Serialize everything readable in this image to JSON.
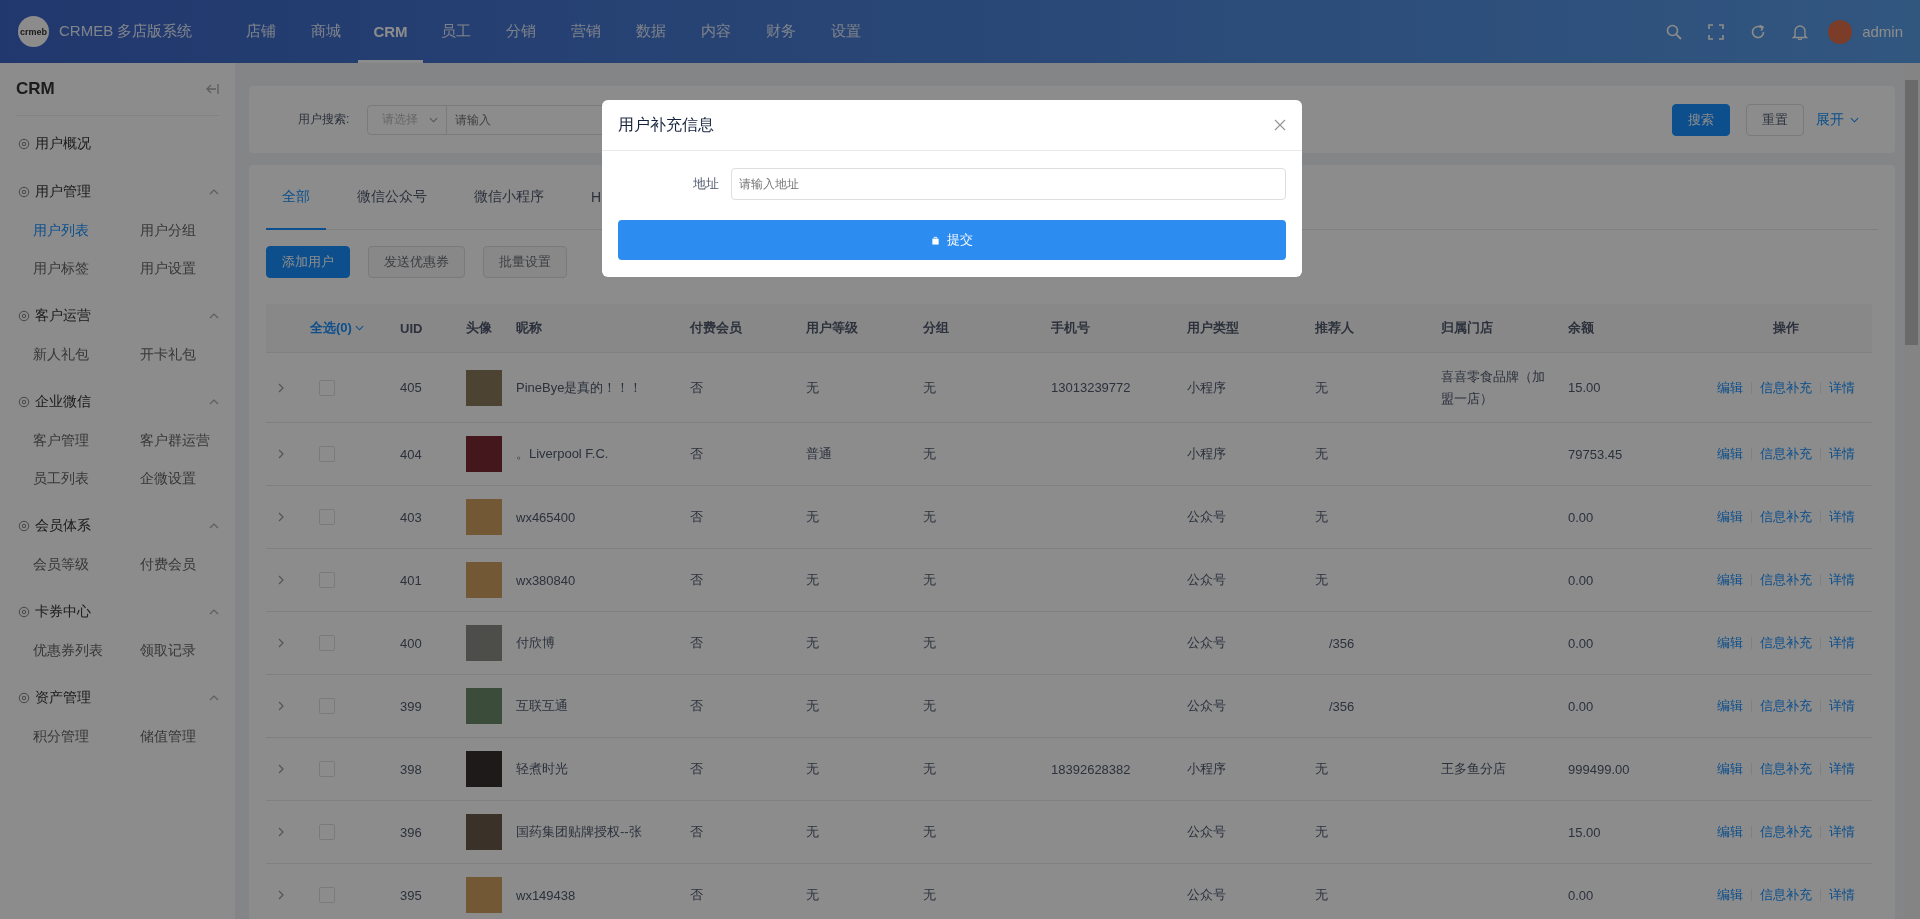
{
  "header": {
    "logo_text": "crmeb",
    "system_name": "CRMEB 多店版系统",
    "nav": [
      {
        "label": "店铺",
        "selected": false
      },
      {
        "label": "商城",
        "selected": false
      },
      {
        "label": "CRM",
        "selected": true
      },
      {
        "label": "员工",
        "selected": false
      },
      {
        "label": "分销",
        "selected": false
      },
      {
        "label": "营销",
        "selected": false
      },
      {
        "label": "数据",
        "selected": false
      },
      {
        "label": "内容",
        "selected": false
      },
      {
        "label": "财务",
        "selected": false
      },
      {
        "label": "设置",
        "selected": false
      }
    ],
    "user": "admin"
  },
  "sidebar": {
    "title": "CRM",
    "groups": [
      {
        "label": "用户概况"
      },
      {
        "label": "用户管理",
        "expanded": true,
        "children": [
          {
            "label": "用户列表",
            "selected": true
          },
          {
            "label": "用户分组",
            "selected": false
          },
          {
            "label": "用户标签",
            "selected": false
          },
          {
            "label": "用户设置",
            "selected": false
          }
        ]
      },
      {
        "label": "客户运营",
        "expanded": true,
        "children": [
          {
            "label": "新人礼包",
            "selected": false
          },
          {
            "label": "开卡礼包",
            "selected": false
          }
        ]
      },
      {
        "label": "企业微信",
        "expanded": true,
        "children": [
          {
            "label": "客户管理",
            "selected": false
          },
          {
            "label": "客户群运营",
            "selected": false
          },
          {
            "label": "员工列表",
            "selected": false
          },
          {
            "label": "企微设置",
            "selected": false
          }
        ]
      },
      {
        "label": "会员体系",
        "expanded": true,
        "children": [
          {
            "label": "会员等级",
            "selected": false
          },
          {
            "label": "付费会员",
            "selected": false
          }
        ]
      },
      {
        "label": "卡券中心",
        "expanded": true,
        "children": [
          {
            "label": "优惠券列表",
            "selected": false
          },
          {
            "label": "领取记录",
            "selected": false
          }
        ]
      },
      {
        "label": "资产管理",
        "expanded": true,
        "children": [
          {
            "label": "积分管理",
            "selected": false
          },
          {
            "label": "储值管理",
            "selected": false
          }
        ]
      }
    ]
  },
  "filter": {
    "label": "用户搜索:",
    "select_placeholder": "请选择",
    "input_placeholder": "请输入",
    "buttons": [
      {
        "label": "搜索",
        "kind": "primary"
      },
      {
        "label": "重置",
        "kind": "default"
      }
    ],
    "toggle": "展开"
  },
  "tabs": [
    {
      "label": "全部",
      "selected": true
    },
    {
      "label": "微信公众号",
      "selected": false
    },
    {
      "label": "微信小程序",
      "selected": false
    },
    {
      "label": "H",
      "selected": false
    }
  ],
  "actions": [
    {
      "label": "添加用户",
      "disabled": false
    },
    {
      "label": "发送优惠券",
      "disabled": true
    },
    {
      "label": "批量设置",
      "disabled": true
    }
  ],
  "table": {
    "select_all": "全选(0)",
    "columns": [
      "UID",
      "头像",
      "昵称",
      "付费会员",
      "用户等级",
      "分组",
      "手机号",
      "用户类型",
      "推荐人",
      "归属门店",
      "余额",
      "操作"
    ],
    "rows": [
      {
        "checked": false,
        "uid": "405",
        "nickname": "PineBye是真的！！！",
        "paid": "否",
        "level": "无",
        "group": "无",
        "phone": "13013239772",
        "type": "小程序",
        "referrer": "无",
        "store": "喜喜零食品牌（加盟一店）",
        "balance": "15.00",
        "actions": [
          "编辑",
          "信息补充",
          "详情"
        ]
      },
      {
        "checked": false,
        "uid": "404",
        "nickname": "。Liverpool F.C.",
        "paid": "否",
        "level": "普通",
        "group": "无",
        "phone": "",
        "type": "小程序",
        "referrer": "无",
        "store": "",
        "balance": "79753.45",
        "actions": [
          "编辑",
          "信息补充",
          "详情"
        ]
      },
      {
        "checked": false,
        "uid": "403",
        "nickname": "wx465400",
        "paid": "否",
        "level": "无",
        "group": "无",
        "phone": "",
        "type": "公众号",
        "referrer": "无",
        "store": "",
        "balance": "0.00",
        "actions": [
          "编辑",
          "信息补充",
          "详情"
        ]
      },
      {
        "checked": false,
        "uid": "401",
        "nickname": "wx380840",
        "paid": "否",
        "level": "无",
        "group": "无",
        "phone": "",
        "type": "公众号",
        "referrer": "无",
        "store": "",
        "balance": "0.00",
        "actions": [
          "编辑",
          "信息补充",
          "详情"
        ]
      },
      {
        "checked": false,
        "uid": "400",
        "nickname": "付欣博",
        "paid": "否",
        "level": "无",
        "group": "无",
        "phone": "",
        "type": "公众号",
        "referrer": "/356",
        "store": "",
        "balance": "0.00",
        "actions": [
          "编辑",
          "信息补充",
          "详情"
        ]
      },
      {
        "checked": false,
        "uid": "399",
        "nickname": "互联互通",
        "paid": "否",
        "level": "无",
        "group": "无",
        "phone": "",
        "type": "公众号",
        "referrer": "/356",
        "store": "",
        "balance": "0.00",
        "actions": [
          "编辑",
          "信息补充",
          "详情"
        ]
      },
      {
        "checked": false,
        "uid": "398",
        "nickname": "轻煮时光",
        "paid": "否",
        "level": "无",
        "group": "无",
        "phone": "18392628382",
        "type": "小程序",
        "referrer": "无",
        "store": "王多鱼分店",
        "balance": "999499.00",
        "actions": [
          "编辑",
          "信息补充",
          "详情"
        ]
      },
      {
        "checked": false,
        "uid": "396",
        "nickname": "国药集团贴牌授权--张",
        "paid": "否",
        "level": "无",
        "group": "无",
        "phone": "",
        "type": "公众号",
        "referrer": "无",
        "store": "",
        "balance": "15.00",
        "actions": [
          "编辑",
          "信息补充",
          "详情"
        ]
      },
      {
        "checked": false,
        "uid": "395",
        "nickname": "wx149438",
        "paid": "否",
        "level": "无",
        "group": "无",
        "phone": "",
        "type": "公众号",
        "referrer": "无",
        "store": "",
        "balance": "0.00",
        "actions": [
          "编辑",
          "信息补充",
          "详情"
        ]
      }
    ]
  },
  "modal": {
    "title": "用户补充信息",
    "field_label": "地址",
    "field_placeholder": "请输入地址",
    "submit": "提交"
  }
}
